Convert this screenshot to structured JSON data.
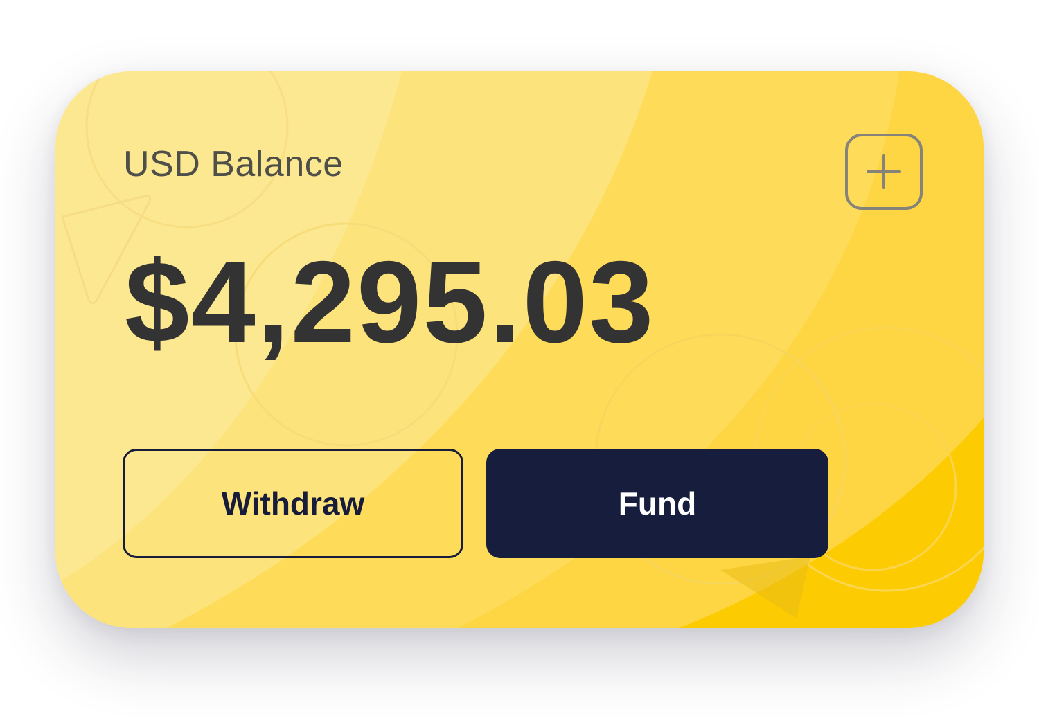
{
  "card": {
    "label": "USD Balance",
    "amount": "$4,295.03",
    "add_icon": "plus-icon"
  },
  "actions": {
    "withdraw_label": "Withdraw",
    "fund_label": "Fund"
  },
  "colors": {
    "card_light": "#FDE98F",
    "card_mid": "#FEDD5A",
    "card_accent": "#FDCB02",
    "label_text": "#4F4F4A",
    "amount_text": "#333333",
    "button_dark": "#171D3D",
    "button_text_light": "#FFFFFF"
  }
}
